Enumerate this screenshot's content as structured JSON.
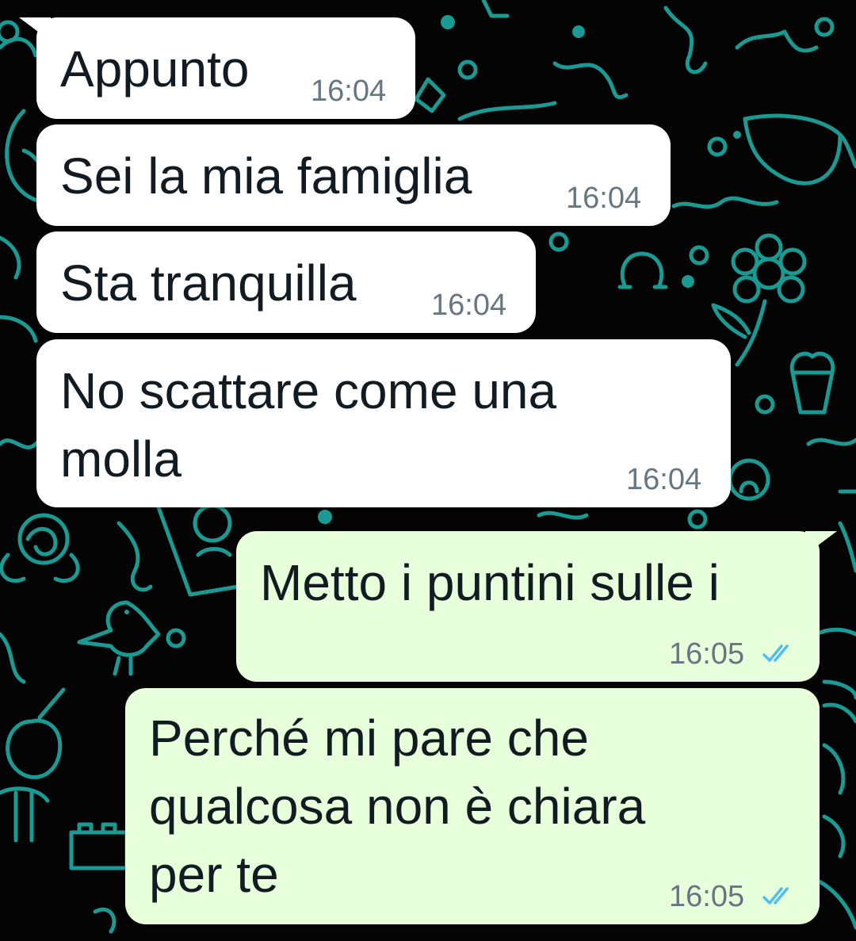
{
  "theme": {
    "background": "#040404",
    "doodle_color": "#1fb5ad",
    "incoming_bubble": "#ffffff",
    "outgoing_bubble": "#e7ffdb",
    "text_color": "#111b21",
    "time_color": "#667781",
    "read_tick_color": "#53bdeb"
  },
  "messages": [
    {
      "direction": "incoming",
      "lines": [
        "Appunto"
      ],
      "time": "16:04"
    },
    {
      "direction": "incoming",
      "lines": [
        "Sei la mia famiglia"
      ],
      "time": "16:04"
    },
    {
      "direction": "incoming",
      "lines": [
        "Sta tranquilla"
      ],
      "time": "16:04"
    },
    {
      "direction": "incoming",
      "lines": [
        "No scattare come una",
        "molla"
      ],
      "time": "16:04"
    },
    {
      "direction": "outgoing",
      "lines": [
        "Metto i puntini sulle i"
      ],
      "time": "16:05",
      "status_icon": "double-check-read-icon"
    },
    {
      "direction": "outgoing",
      "lines": [
        "Perché mi pare che",
        "qualcosa non è chiara",
        "per te"
      ],
      "time": "16:05",
      "status_icon": "double-check-read-icon"
    }
  ]
}
